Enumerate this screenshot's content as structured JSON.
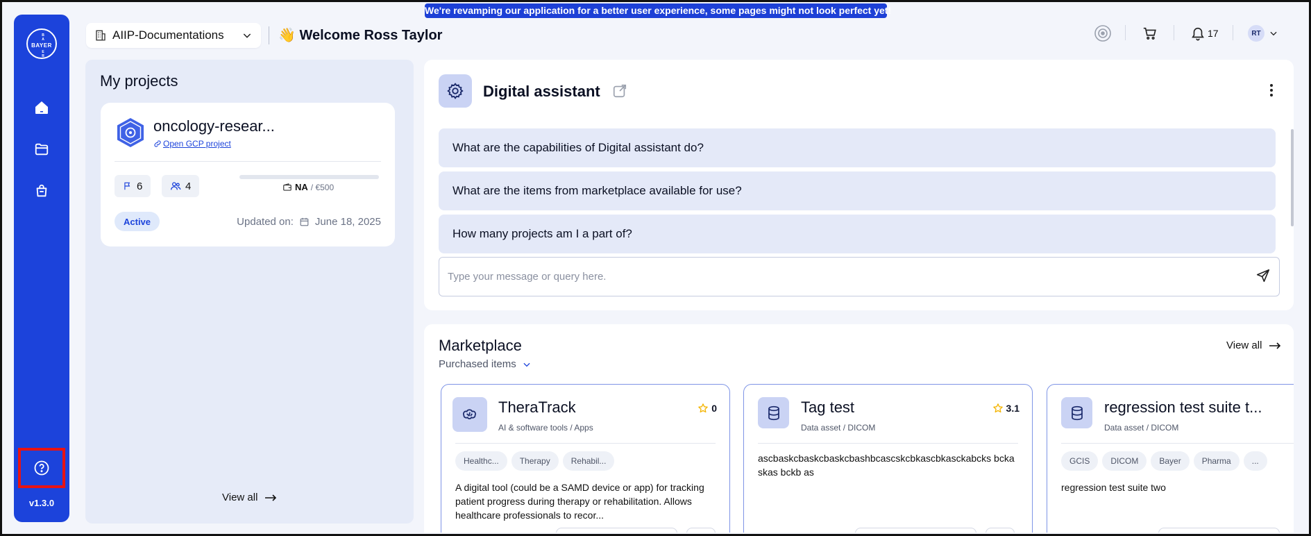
{
  "banner": {
    "text": "We're revamping our application for a better user experience, some pages might not look perfect yet!"
  },
  "sidebar": {
    "logo_h": "BAYER",
    "logo_v": "BAYER",
    "version": "v1.3.0"
  },
  "header": {
    "org_select": "AIIP-Documentations",
    "welcome_emoji": "👋",
    "welcome": "Welcome Ross Taylor",
    "notification_count": "17",
    "avatar_initials": "RT"
  },
  "projects": {
    "title": "My projects",
    "card": {
      "name": "oncology-resear...",
      "link": "Open GCP project",
      "flags": "6",
      "members": "4",
      "budget_used": "NA",
      "budget_total": "/ €500",
      "status": "Active",
      "updated_label": "Updated on:",
      "updated_date": "June 18, 2025"
    },
    "view_all": "View all"
  },
  "assistant": {
    "title": "Digital assistant",
    "suggestions": [
      "What are the capabilities of Digital assistant do?",
      "What are the items from marketplace available for use?",
      "How many projects am I a part of?"
    ],
    "input_placeholder": "Type your message or query here."
  },
  "marketplace": {
    "title": "Marketplace",
    "filter": "Purchased items",
    "view_all": "View all",
    "items": [
      {
        "name": "TheraTrack",
        "category": "AI & software tools / Apps",
        "rating": "0",
        "tags": [
          "Healthc...",
          "Therapy",
          "Rehabil..."
        ],
        "description": "A digital tool (could be a SAMD device or app) for tracking patient progress during therapy or rehabilitation. Allows healthcare professionals to recor..."
      },
      {
        "name": "Tag test",
        "category": "Data asset / DICOM",
        "rating": "3.1",
        "tags": [],
        "description": "ascbaskcbaskcbaskcbashbcascskcbkascbkasckabcks bckaskas bckb as"
      },
      {
        "name": "regression test suite t...",
        "category": "Data asset / DICOM",
        "rating": "",
        "tags": [
          "GCIS",
          "DICOM",
          "Bayer",
          "Pharma",
          "..."
        ],
        "description": "regression test suite two"
      }
    ]
  },
  "colors": {
    "brand": "#1c43db",
    "page_bg": "#f3f5fb",
    "panel_bg": "#e6ebf8",
    "highlight_box": "#e81313",
    "star": "#f4b400"
  }
}
